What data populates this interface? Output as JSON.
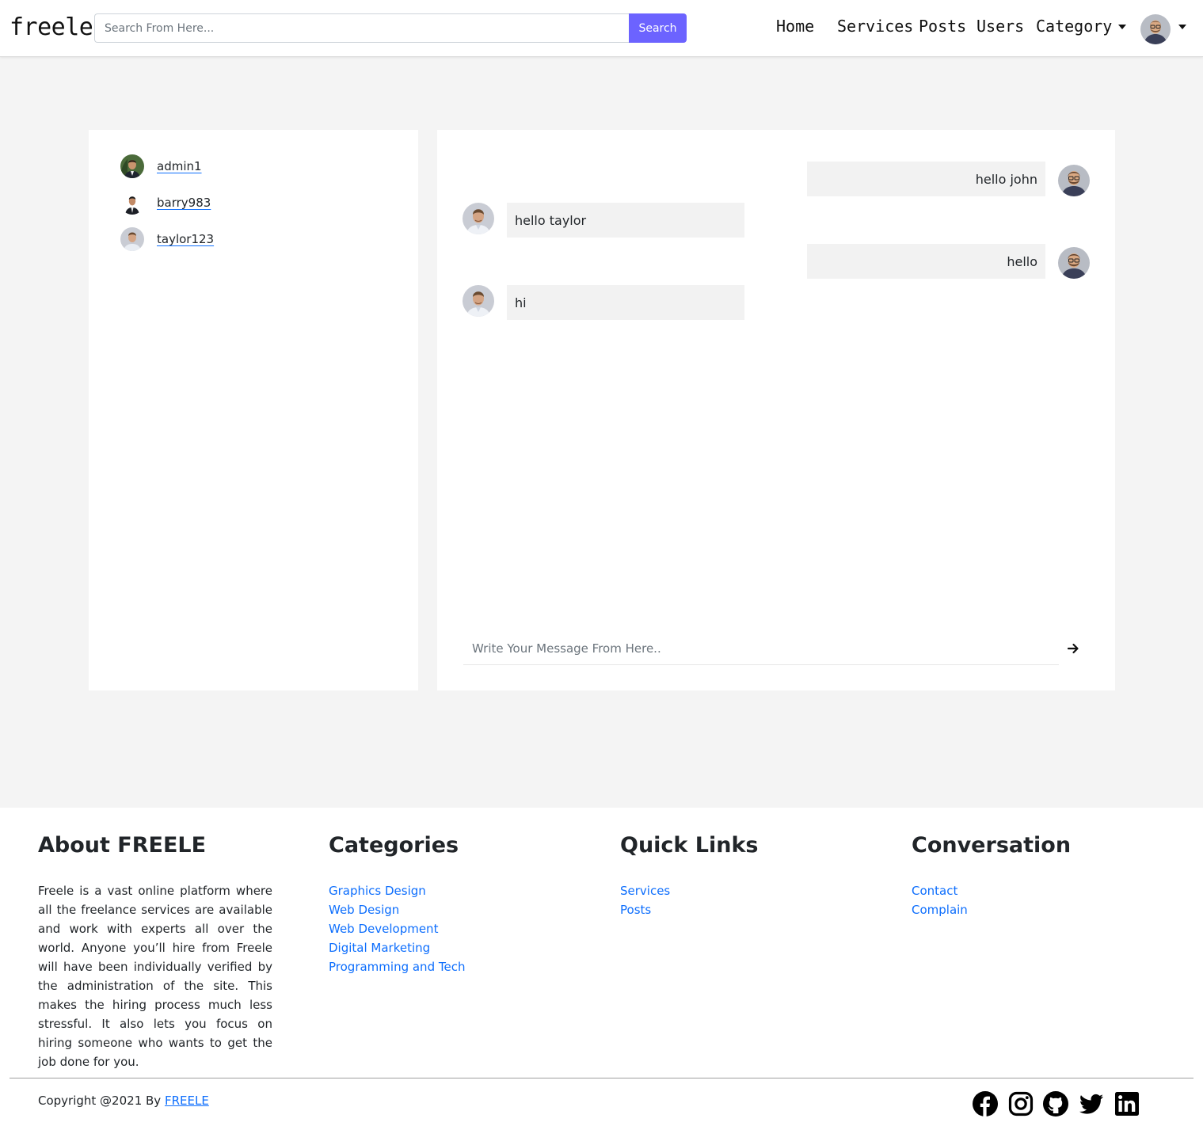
{
  "navbar": {
    "brand": "freele",
    "search_placeholder": "Search From Here...",
    "search_button": "Search",
    "links": [
      "Home",
      "Services",
      "Posts",
      "Users",
      "Category"
    ]
  },
  "users": [
    {
      "name": "admin1"
    },
    {
      "name": "barry983"
    },
    {
      "name": "taylor123"
    }
  ],
  "messages": [
    {
      "text": "hello john",
      "direction": "sent"
    },
    {
      "text": "hello taylor",
      "direction": "received"
    },
    {
      "text": "hello",
      "direction": "sent"
    },
    {
      "text": "hi",
      "direction": "received"
    }
  ],
  "composer": {
    "placeholder": "Write Your Message From Here.."
  },
  "footer": {
    "about": {
      "heading": "About FREELE",
      "text": "Freele is a vast online platform where all the freelance services are available and work with experts all over the world. Anyone you’ll hire from Freele will have been individually verified by the administration of the site. This makes the hiring process much less stressful. It also lets you focus on hiring someone who wants to get the job done for you."
    },
    "categories": {
      "heading": "Categories",
      "links": [
        "Graphics Design",
        "Web Design",
        "Web Development",
        "Digital Marketing",
        "Programming and Tech"
      ]
    },
    "quick_links": {
      "heading": "Quick Links",
      "links": [
        "Services",
        "Posts"
      ]
    },
    "conversation": {
      "heading": "Conversation",
      "links": [
        "Contact",
        "Complain"
      ]
    },
    "copyright_prefix": "Copyright @2021 By ",
    "copyright_link": "FREELE",
    "social_icons": [
      "facebook-icon",
      "instagram-icon",
      "github-icon",
      "twitter-icon",
      "linkedin-icon"
    ]
  },
  "colors": {
    "accent": "#6c63ff",
    "link": "#0d6efd",
    "page_bg": "#f4f4f4",
    "bubble_bg": "#f2f2f2"
  }
}
